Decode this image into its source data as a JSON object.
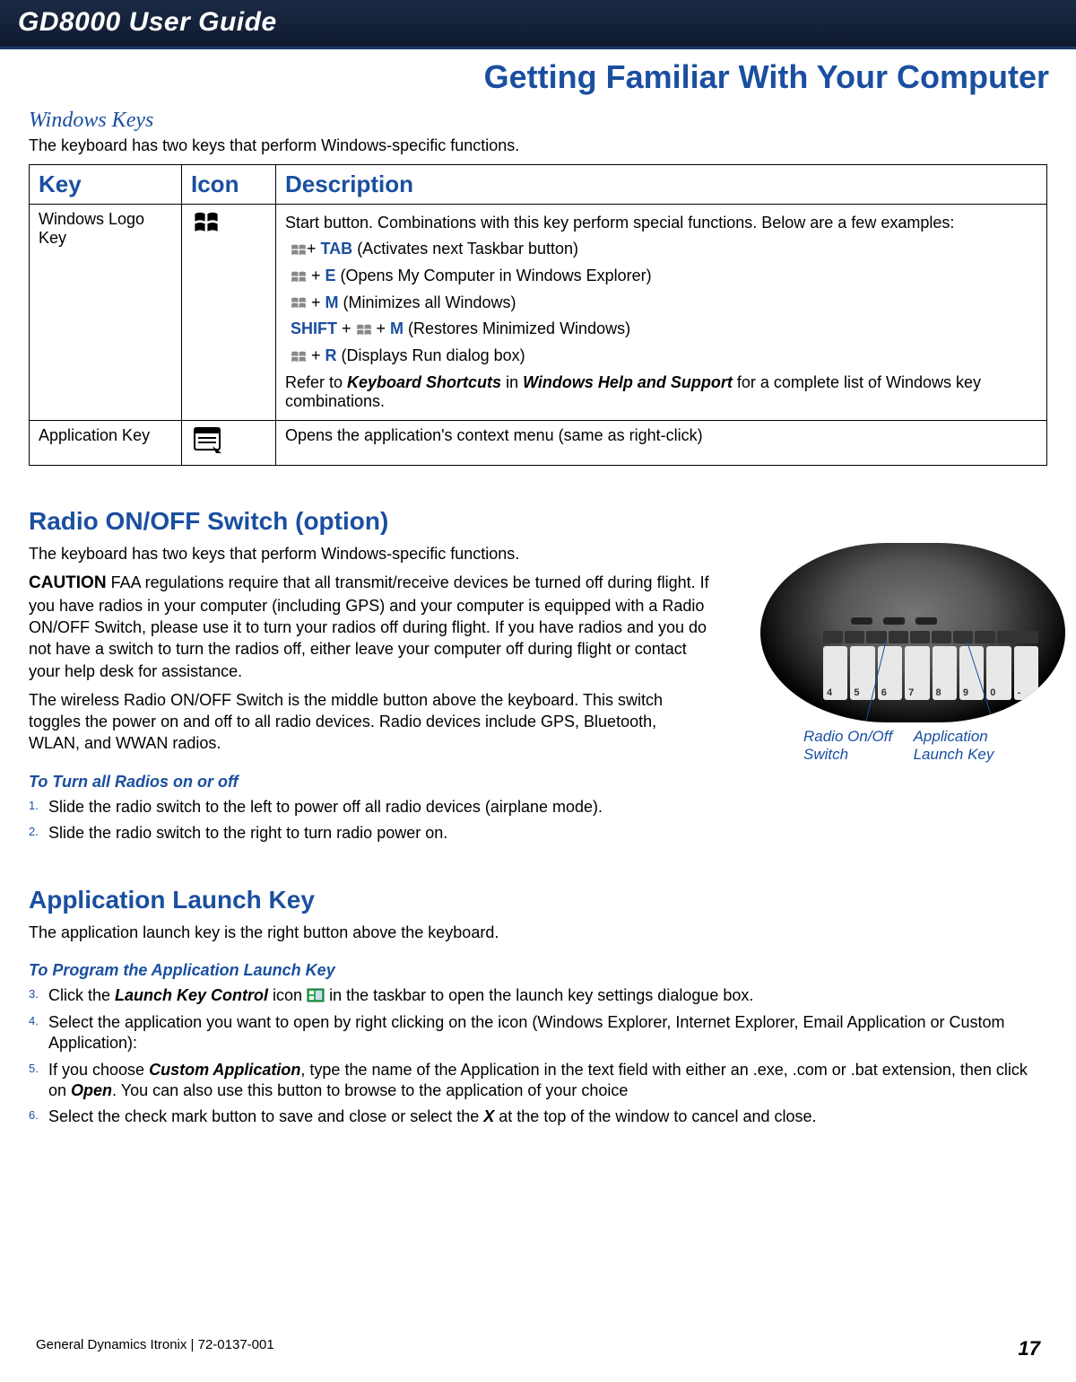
{
  "header": {
    "title": "GD8000 User Guide"
  },
  "page_title": "Getting Familiar With Your Computer",
  "windows_keys": {
    "heading": "Windows Keys",
    "intro": "The keyboard has two keys that perform Windows-specific functions.",
    "columns": {
      "key": "Key",
      "icon": "Icon",
      "desc": "Description"
    },
    "rows": [
      {
        "key": "Windows Logo Key",
        "desc_intro": "Start button. Combinations with this key perform special functions. Below are a few examples:",
        "combos": [
          {
            "pre": "",
            "key": "TAB",
            "post": " (Activates next Taskbar button)"
          },
          {
            "pre": " ",
            "key": "E",
            "post": " (Opens My Computer in Windows Explorer)"
          },
          {
            "pre": " ",
            "key": "M",
            "post": " (Minimizes all Windows)"
          },
          {
            "shift": "SHIFT",
            "mid": " + ",
            "key": "M",
            "post": " (Restores Minimized Windows)"
          },
          {
            "pre": " ",
            "key": "R",
            "post": " (Displays Run dialog box)"
          }
        ],
        "refer_pre": "Refer to ",
        "refer_b1": "Keyboard Shortcuts",
        "refer_mid": " in ",
        "refer_b2": "Windows Help and Support",
        "refer_post": " for a complete list of Windows key combinations."
      },
      {
        "key": "Application Key",
        "desc": "Opens the application's context menu (same as right-click)"
      }
    ]
  },
  "radio": {
    "heading": "Radio ON/OFF Switch (option)",
    "intro": "The keyboard has two keys that perform Windows-specific functions.",
    "caution_label": "CAUTION",
    "caution_body": "  FAA regulations require that all transmit/receive devices be turned off during flight.  If you have radios in your computer (including GPS) and your computer is equipped with a Radio ON/OFF Switch, please use it to turn your radios off during flight.  If you have radios and you do not have a switch to turn the radios off, either leave your computer off during flight or contact your help desk for assistance.",
    "detail": "The wireless Radio ON/OFF Switch is the middle button above the keyboard.  This switch toggles the power on and off to all radio devices.  Radio devices include GPS, Bluetooth, WLAN, and WWAN radios.",
    "sub_head": "To Turn all Radios on or off",
    "steps": [
      "Slide the radio switch to the left to power off all radio devices (airplane mode).",
      "Slide the radio switch to the right to turn radio power on."
    ],
    "fig": {
      "label_left": "Radio On/Off Switch",
      "label_right": "Application Launch Key"
    }
  },
  "app_launch": {
    "heading": "Application Launch Key",
    "intro": "The application launch key is the right button above the keyboard.",
    "sub_head": "To Program the Application Launch Key",
    "step3_a": "Click the ",
    "step3_b": "Launch Key Control",
    "step3_c": " icon ",
    "step3_d": " in the taskbar to open the launch key settings dialogue box.",
    "step4": "Select the application you want to open by right clicking on the icon (Windows Explorer, Internet Explorer, Email Application or Custom Application):",
    "step5_a": "If you choose ",
    "step5_b": "Custom Application",
    "step5_c": ", type the name of the Application in the text field with either an .exe, .com or .bat extension, then click on ",
    "step5_d": "Open",
    "step5_e": ". You can also use this button to browse to the application of your choice",
    "step6_a": "Select the check mark button to save and close or select the ",
    "step6_b": "X",
    "step6_c": " at the top of the window to cancel and close."
  },
  "footer": {
    "left": "General Dynamics Itronix | 72-0137-001",
    "page": "17"
  }
}
